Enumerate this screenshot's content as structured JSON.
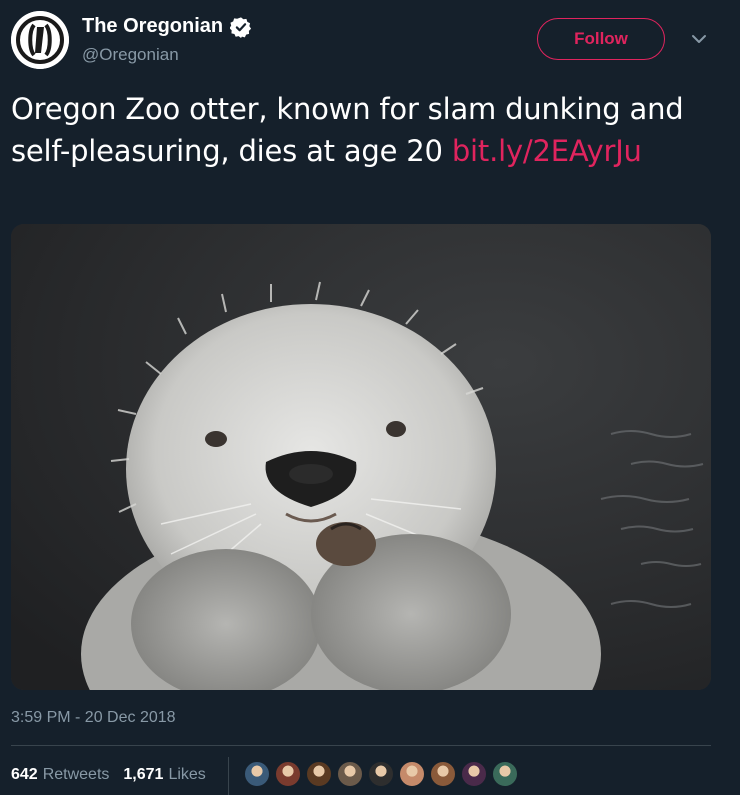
{
  "account": {
    "display_name": "The Oregonian",
    "handle": "@Oregonian",
    "verified": true,
    "avatar_icon": "oregonian-logo-icon"
  },
  "actions": {
    "follow_label": "Follow",
    "more_icon": "chevron-down-icon"
  },
  "tweet": {
    "text": "Oregon Zoo otter, known for slam dunking and self-pleasuring, dies at age 20 ",
    "link_text": "bit.ly/2EAyrJu",
    "media_icon": "sea-otter-photo",
    "timestamp": "3:59 PM - 20 Dec 2018"
  },
  "stats": {
    "retweets_count": "642",
    "retweets_label": "Retweets",
    "likes_count": "1,671",
    "likes_label": "Likes"
  },
  "likers": [
    {
      "color": "#3a5a78"
    },
    {
      "color": "#7a3b2e"
    },
    {
      "color": "#5a3a22"
    },
    {
      "color": "#6b5a4a"
    },
    {
      "color": "#2e2e2e"
    },
    {
      "color": "#c58a6a"
    },
    {
      "color": "#8a5a3a"
    },
    {
      "color": "#4a2a4a"
    },
    {
      "color": "#3a6a5a"
    }
  ],
  "colors": {
    "background": "#15202b",
    "accent": "#e0245e",
    "secondary_text": "#8899a6",
    "divider": "#38444d"
  }
}
